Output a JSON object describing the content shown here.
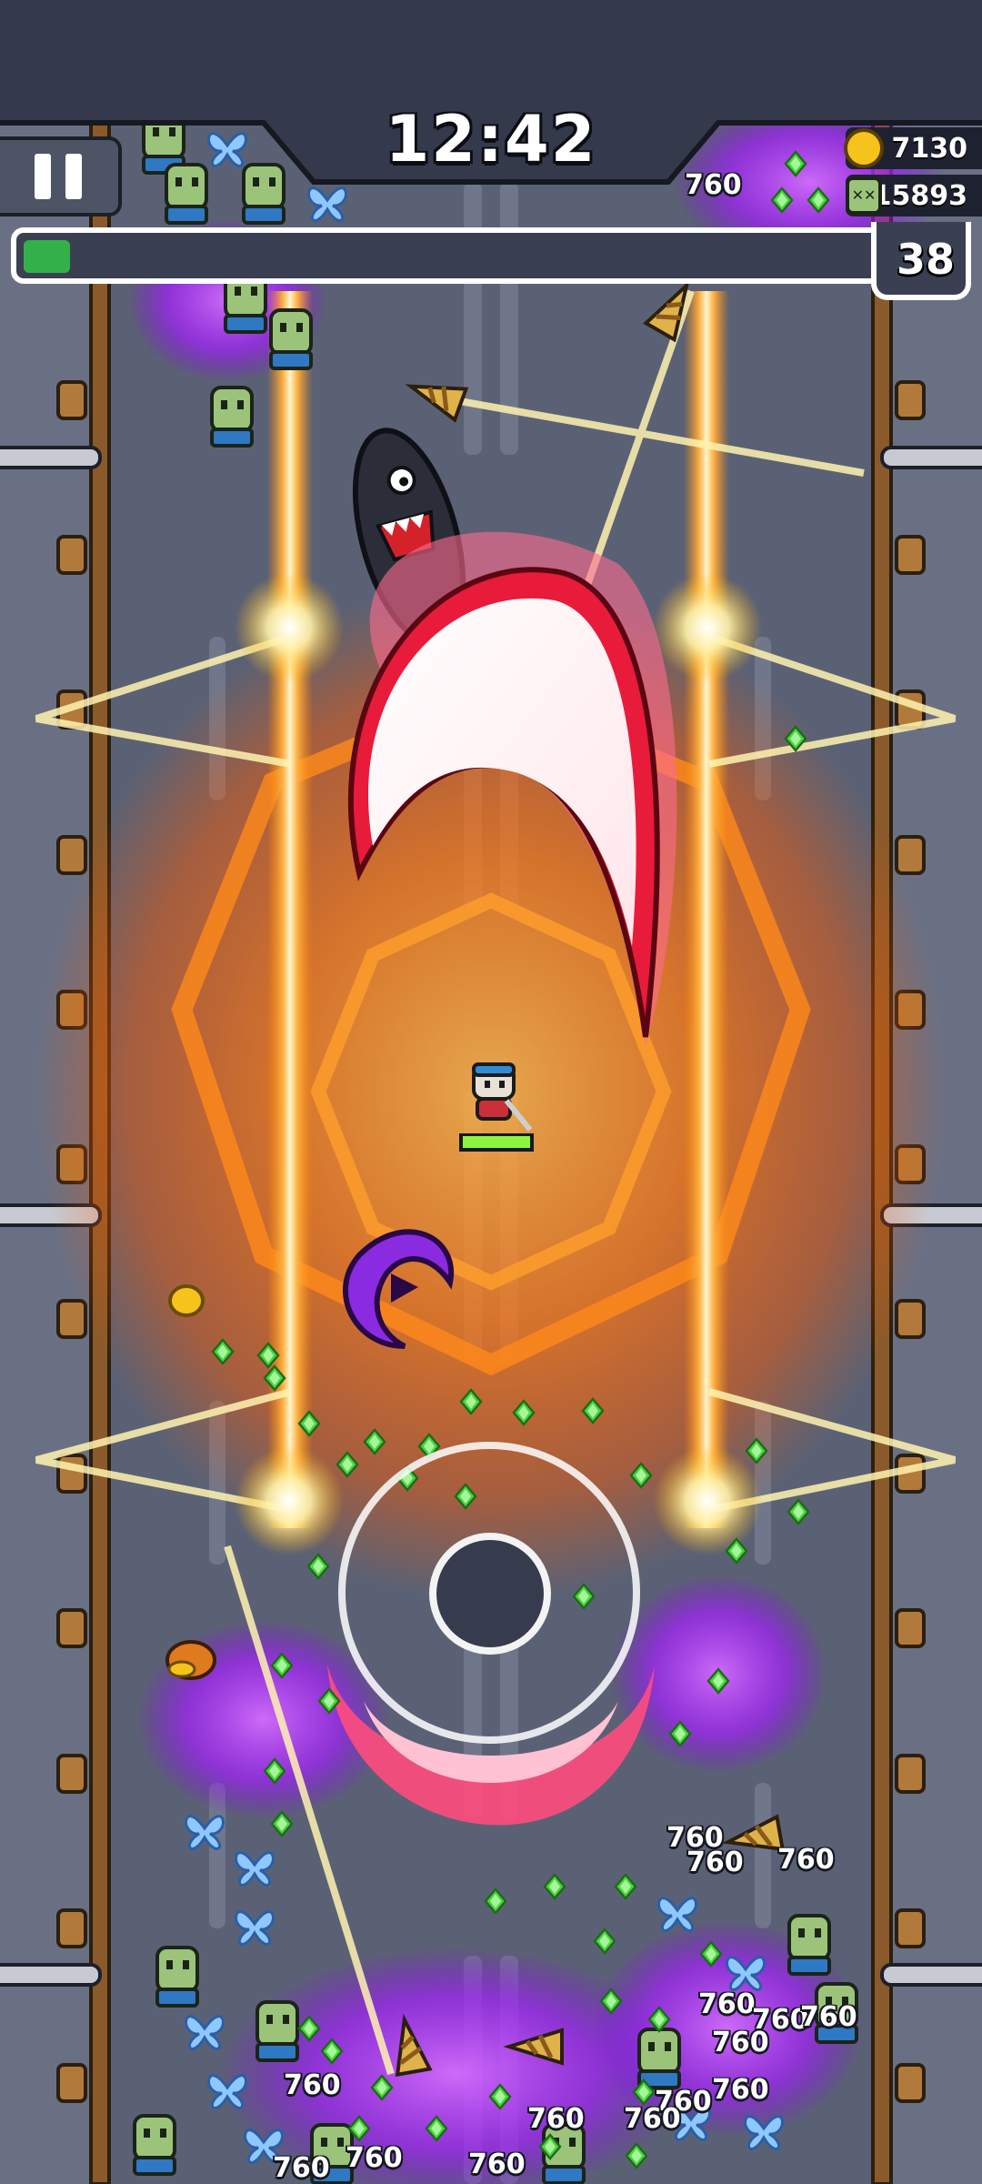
{
  "hud": {
    "timer": "12:42",
    "gold": "7130",
    "kills": "15893",
    "level": "38",
    "xp_progress": 0.05,
    "icons": {
      "pause": "pause-icon",
      "gold": "gold-coin-icon",
      "kills": "zombie-kill-icon"
    }
  },
  "damage_numbers": [
    "760",
    "760",
    "760",
    "760",
    "760",
    "760",
    "760",
    "760",
    "760",
    "760",
    "760",
    "760",
    "760",
    "760",
    "760",
    "760"
  ],
  "colors": {
    "road": "#5b6174",
    "laser": "#ff9a2e",
    "aura": "#ff7a14",
    "slash": "#e81b3a",
    "poison": "#b024ff",
    "gem": "#49d33e",
    "xp_fill": "#34b04a"
  }
}
